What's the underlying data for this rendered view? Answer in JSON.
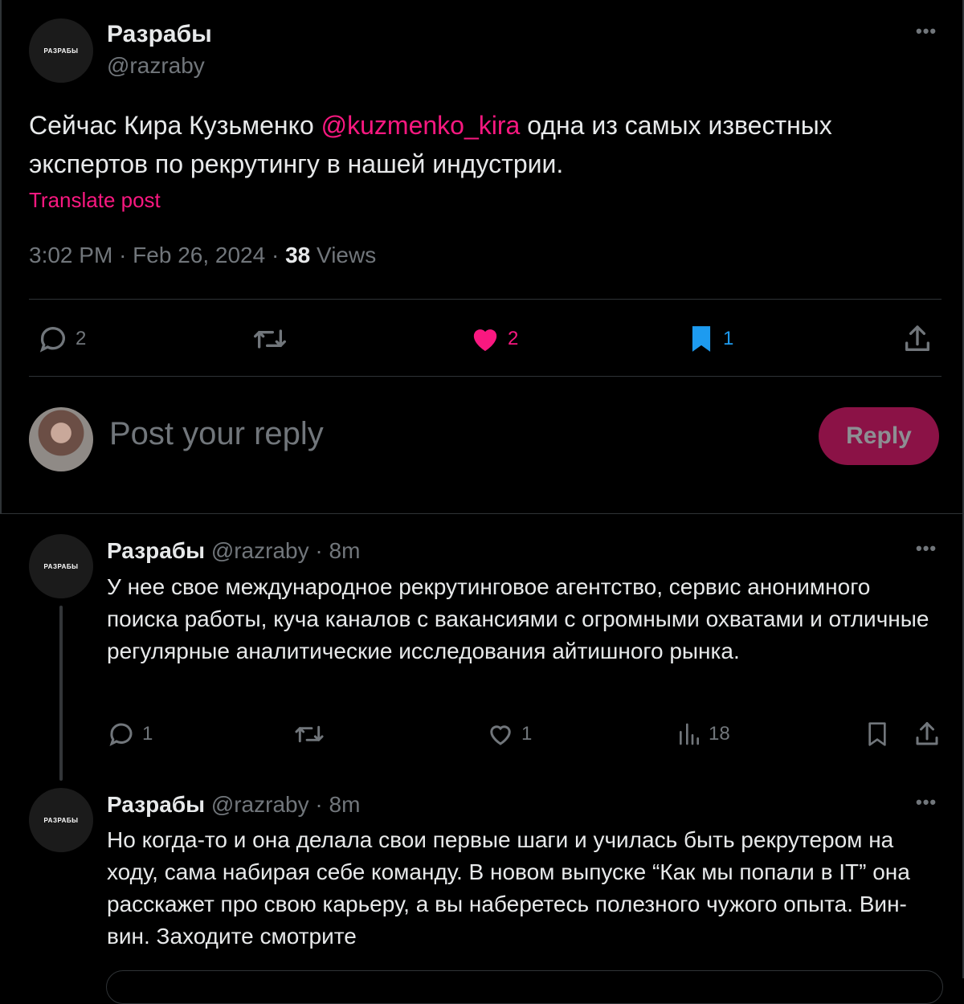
{
  "main_post": {
    "author_name": "Разрабы",
    "author_handle": "@razraby",
    "avatar_text": "РАЗРАБЫ",
    "text_before": "Сейчас Кира Кузьменко ",
    "mention": "@kuzmenko_kira",
    "text_after": " одна из самых известных экспертов по рекрутингу в нашей индустрии.",
    "translate_label": "Translate post",
    "time": "3:02 PM",
    "date": "Feb 26, 2024",
    "views_count": "38",
    "views_label": "Views",
    "actions": {
      "replies": "2",
      "likes": "2",
      "bookmarks": "1"
    }
  },
  "reply_box": {
    "placeholder": "Post your reply",
    "button_label": "Reply"
  },
  "thread": [
    {
      "author_name": "Разрабы",
      "author_handle": "@razraby",
      "time_ago": "8m",
      "avatar_text": "РАЗРАБЫ",
      "text": "У нее свое международное рекрутинговое агентство, сервис анонимного поиска работы, куча каналов с вакансиями с огромными охватами и отличные регулярные аналитические исследования айтишного рынка.",
      "actions": {
        "replies": "1",
        "likes": "1",
        "views": "18"
      }
    },
    {
      "author_name": "Разрабы",
      "author_handle": "@razraby",
      "time_ago": "8m",
      "avatar_text": "РАЗРАБЫ",
      "text": "Но когда-то и она делала свои первые шаги и училась быть рекрутером на ходу, сама набирая себе команду. В новом выпуске “Как мы попали в IT” она расскажет про свою карьеру, а вы наберетесь полезного чужого опыта. Вин-вин. Заходите смотрите"
    }
  ],
  "colors": {
    "background": "#000000",
    "accent_pink": "#f91880",
    "bookmark_blue": "#1d9bf0",
    "muted": "#71767b",
    "reply_button": "#8b1246"
  },
  "icons": [
    "comment-icon",
    "retweet-icon",
    "heart-icon",
    "bookmark-icon",
    "share-icon",
    "analytics-icon",
    "more-icon"
  ]
}
